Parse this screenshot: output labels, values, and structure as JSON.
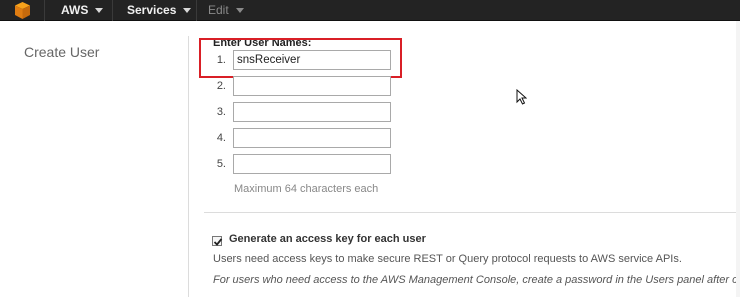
{
  "topnav": {
    "logo_icon": "aws-cube-icon",
    "aws_label": "AWS",
    "services_label": "Services",
    "edit_label": "Edit"
  },
  "page": {
    "left_title": "Create User"
  },
  "form": {
    "enter_label": "Enter User Names:",
    "rows": [
      {
        "num": "1.",
        "value": "snsReceiver"
      },
      {
        "num": "2.",
        "value": ""
      },
      {
        "num": "3.",
        "value": ""
      },
      {
        "num": "4.",
        "value": ""
      },
      {
        "num": "5.",
        "value": ""
      }
    ],
    "hint": "Maximum 64 characters each",
    "generate_key": {
      "label": "Generate an access key for each user",
      "checked": true
    },
    "info_line1": "Users need access keys to make secure REST or Query protocol requests to AWS service APIs.",
    "info_line2": "For users who need access to the AWS Management Console, create a password in the Users panel after co"
  },
  "colors": {
    "topbar": "#232323",
    "highlight": "#d91f26",
    "aws_orange": "#f7a21b"
  }
}
